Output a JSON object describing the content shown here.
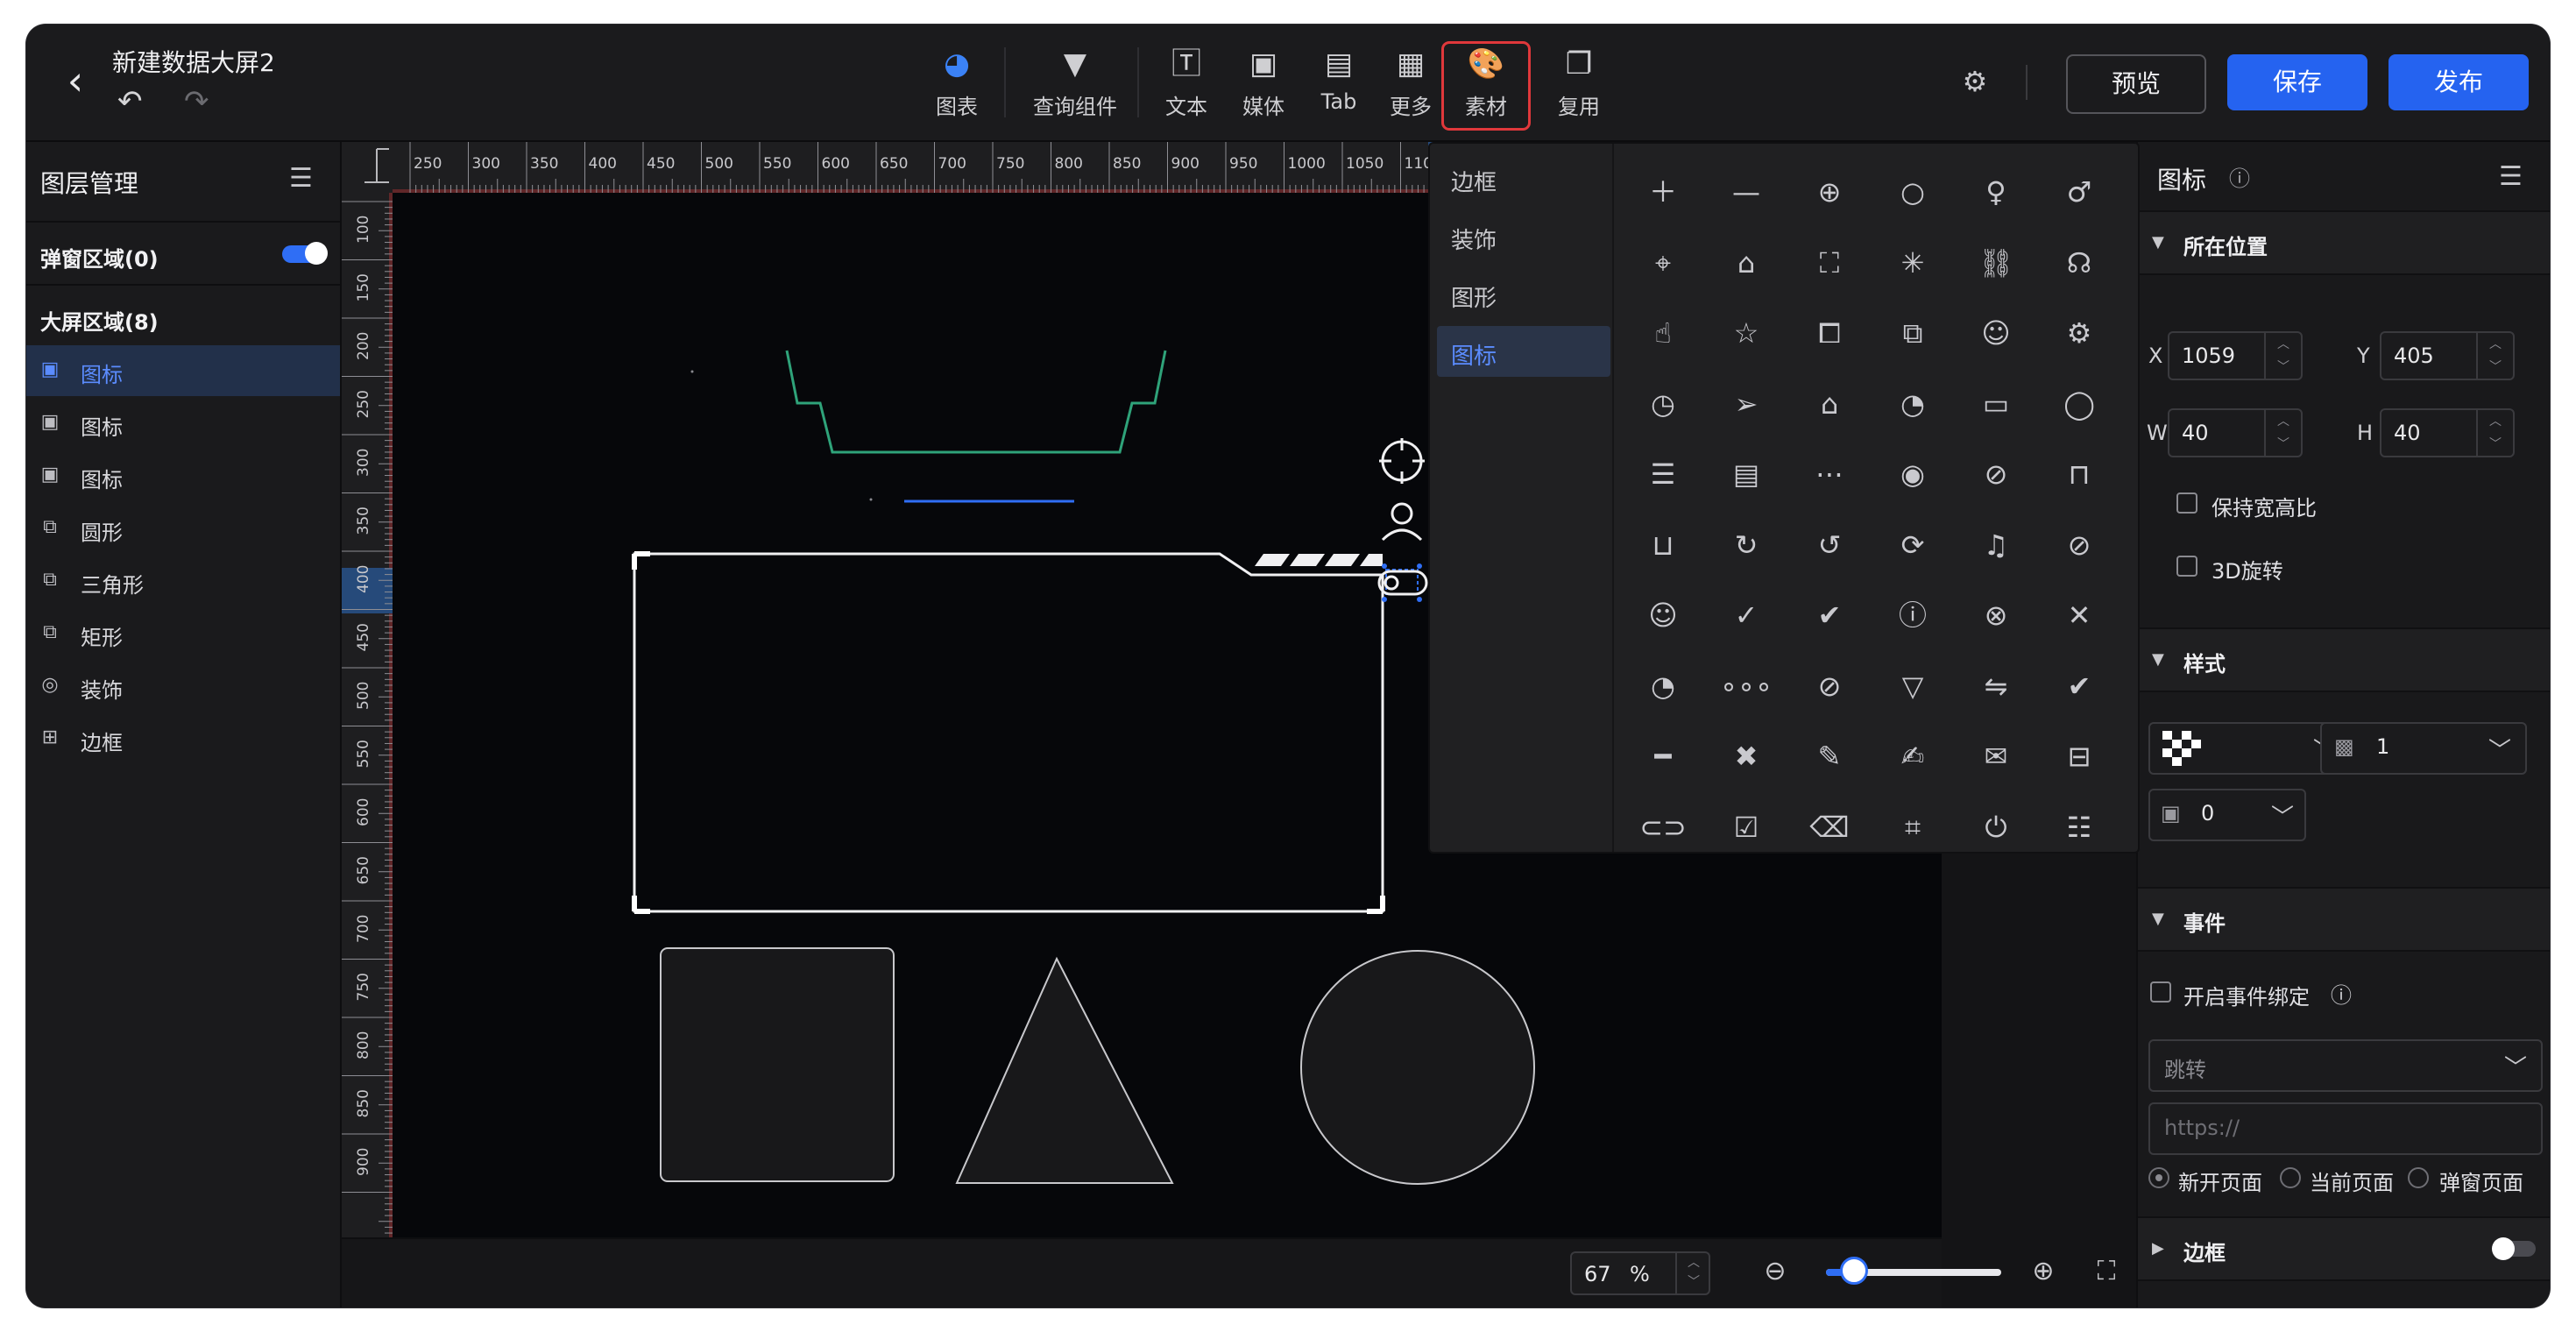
{
  "header": {
    "title": "新建数据大屏2",
    "back_icon": "chevron-left-icon",
    "undo_icon": "undo-icon",
    "redo_icon": "redo-icon",
    "tools": [
      {
        "label": "图表",
        "icon": "chart-pie-icon"
      },
      {
        "label": "查询组件",
        "icon": "filter-icon"
      },
      {
        "label": "文本",
        "icon": "text-icon"
      },
      {
        "label": "媒体",
        "icon": "image-icon"
      },
      {
        "label": "Tab",
        "icon": "tab-icon"
      },
      {
        "label": "更多",
        "icon": "grid-icon"
      },
      {
        "label": "素材",
        "icon": "palette-icon"
      },
      {
        "label": "复用",
        "icon": "copy-icon"
      }
    ],
    "preview_label": "预览",
    "save_label": "保存",
    "publish_label": "发布"
  },
  "layers": {
    "title": "图层管理",
    "popup_section": "弹窗区域(0)",
    "popup_toggle_on": true,
    "screen_section": "大屏区域(8)",
    "items": [
      {
        "name": "图标",
        "icon": "image-icon",
        "selected": true
      },
      {
        "name": "图标",
        "icon": "image-icon"
      },
      {
        "name": "图标",
        "icon": "image-icon"
      },
      {
        "name": "圆形",
        "icon": "shape-icon"
      },
      {
        "name": "三角形",
        "icon": "shape-icon"
      },
      {
        "name": "矩形",
        "icon": "shape-icon"
      },
      {
        "name": "装饰",
        "icon": "decoration-icon"
      },
      {
        "name": "边框",
        "icon": "border-icon"
      }
    ]
  },
  "ruler": {
    "top_labels": [
      "250",
      "300",
      "350",
      "400",
      "450",
      "500",
      "550",
      "600",
      "650",
      "700",
      "750",
      "800",
      "850",
      "900",
      "950",
      "1000",
      "1050",
      "110"
    ],
    "left_labels": [
      "100",
      "150",
      "200",
      "250",
      "300",
      "350",
      "400",
      "450",
      "500",
      "550",
      "600",
      "650",
      "700",
      "750",
      "800",
      "850",
      "900"
    ]
  },
  "canvas": {
    "accent_green": "#2fa37a",
    "accent_blue": "#2f6ef5"
  },
  "zoom": {
    "value": "67",
    "unit": "%",
    "slider_fraction": 0.16
  },
  "material_popup": {
    "categories": [
      {
        "label": "边框"
      },
      {
        "label": "装饰"
      },
      {
        "label": "图形"
      },
      {
        "label": "图标",
        "selected": true
      }
    ],
    "icons": [
      "plus-icon",
      "minus-icon",
      "plus-circle-icon",
      "search-icon",
      "female-icon",
      "male-icon",
      "crosshair-icon",
      "home-icon",
      "fullscreen-icon",
      "loading-icon",
      "link-icon",
      "headset-icon",
      "pointer-icon",
      "star-icon",
      "notification-icon",
      "chat-double-icon",
      "more-chat-icon",
      "gear-icon",
      "clock-icon",
      "send-icon",
      "house-person-icon",
      "dashboard-icon",
      "chat-square-icon",
      "chat-round-icon",
      "comment-icon",
      "message-icon",
      "message-dots-icon",
      "eye-icon",
      "eye-off-icon",
      "unlock-icon",
      "lock-icon",
      "refresh-icon",
      "rotate-left-icon",
      "sync-icon",
      "bell-icon",
      "bell-off-icon",
      "user-icon",
      "check-icon",
      "check-circle-icon",
      "warning-circle-icon",
      "close-circle-icon",
      "close-icon",
      "pie-icon",
      "ellipsis-icon",
      "compass-icon",
      "filter-icon",
      "swap-icon",
      "check-bold-icon",
      "minus-bold-icon",
      "close-bold-icon",
      "edit-icon",
      "edit-square-icon",
      "mail-icon",
      "inbox-icon",
      "toggle-icon",
      "list-check-icon",
      "trash-icon",
      "crop-icon",
      "power-icon",
      "sliders-icon"
    ]
  },
  "properties": {
    "title": "图标",
    "position_section": "所在位置",
    "x_label": "X",
    "x_value": "1059",
    "y_label": "Y",
    "y_value": "405",
    "w_label": "W",
    "w_value": "40",
    "h_label": "H",
    "h_value": "40",
    "keep_ratio_label": "保持宽高比",
    "rotate3d_label": "3D旋转",
    "style_section": "样式",
    "opacity_value": "1",
    "radius_value": "0",
    "event_section": "事件",
    "enable_event_label": "开启事件绑定",
    "jump_select": "跳转",
    "url_placeholder": "https://",
    "open_new": "新开页面",
    "open_current": "当前页面",
    "open_popup": "弹窗页面",
    "border_section": "边框"
  }
}
